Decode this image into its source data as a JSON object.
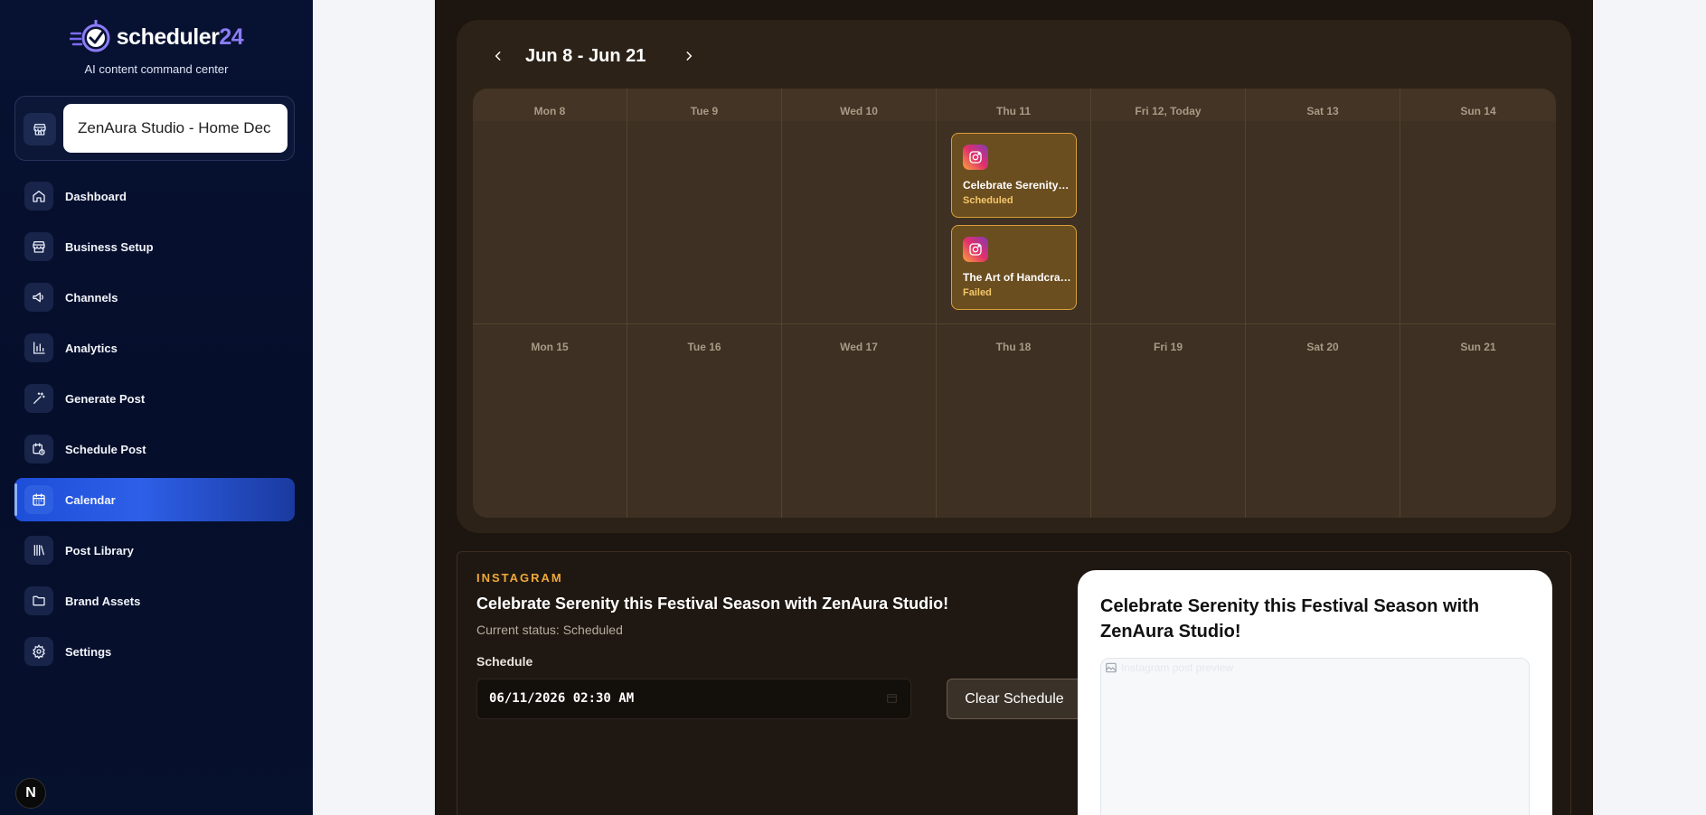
{
  "brand": {
    "name": "scheduler",
    "accent": "24",
    "tagline": "AI content command center"
  },
  "business": {
    "selected": "ZenAura Studio - Home Dec"
  },
  "nav": [
    {
      "label": "Dashboard",
      "icon": "home-icon"
    },
    {
      "label": "Business Setup",
      "icon": "store-icon"
    },
    {
      "label": "Channels",
      "icon": "megaphone-icon"
    },
    {
      "label": "Analytics",
      "icon": "bar-chart-icon"
    },
    {
      "label": "Generate Post",
      "icon": "magic-wand-icon"
    },
    {
      "label": "Schedule Post",
      "icon": "calendar-clock-icon"
    },
    {
      "label": "Calendar",
      "icon": "calendar-icon",
      "active": true
    },
    {
      "label": "Post Library",
      "icon": "library-icon"
    },
    {
      "label": "Brand Assets",
      "icon": "folder-icon"
    },
    {
      "label": "Settings",
      "icon": "gear-icon"
    }
  ],
  "next_badge": "N",
  "calendar": {
    "range_title": "Jun 8 - Jun 21",
    "week1": [
      "Mon 8",
      "Tue 9",
      "Wed 10",
      "Thu 11",
      "Fri 12, Today",
      "Sat 13",
      "Sun 14"
    ],
    "week2": [
      "Mon 15",
      "Tue 16",
      "Wed 17",
      "Thu 18",
      "Fri 19",
      "Sat 20",
      "Sun 21"
    ],
    "posts": [
      {
        "title": "Celebrate Serenity this Festival Season with ZenAura Studio!",
        "status": "Scheduled",
        "platform": "instagram"
      },
      {
        "title": "The Art of Handcrafted Decor",
        "status": "Failed",
        "platform": "instagram"
      }
    ]
  },
  "details": {
    "platform": "INSTAGRAM",
    "title": "Celebrate Serenity this Festival Season with ZenAura Studio!",
    "status_text": "Current status: Scheduled",
    "schedule_label": "Schedule",
    "schedule_value": "06/11/2026 02:30 AM",
    "clear_label": "Clear Schedule",
    "preview_title": "Celebrate Serenity this Festival Season with ZenAura Studio!",
    "preview_alt": "Instagram post preview"
  },
  "colors": {
    "accent": "#1d4ed8",
    "card": "#6b4e1f",
    "scheduled": "#f5c66b",
    "platform": "#f0a93a"
  }
}
